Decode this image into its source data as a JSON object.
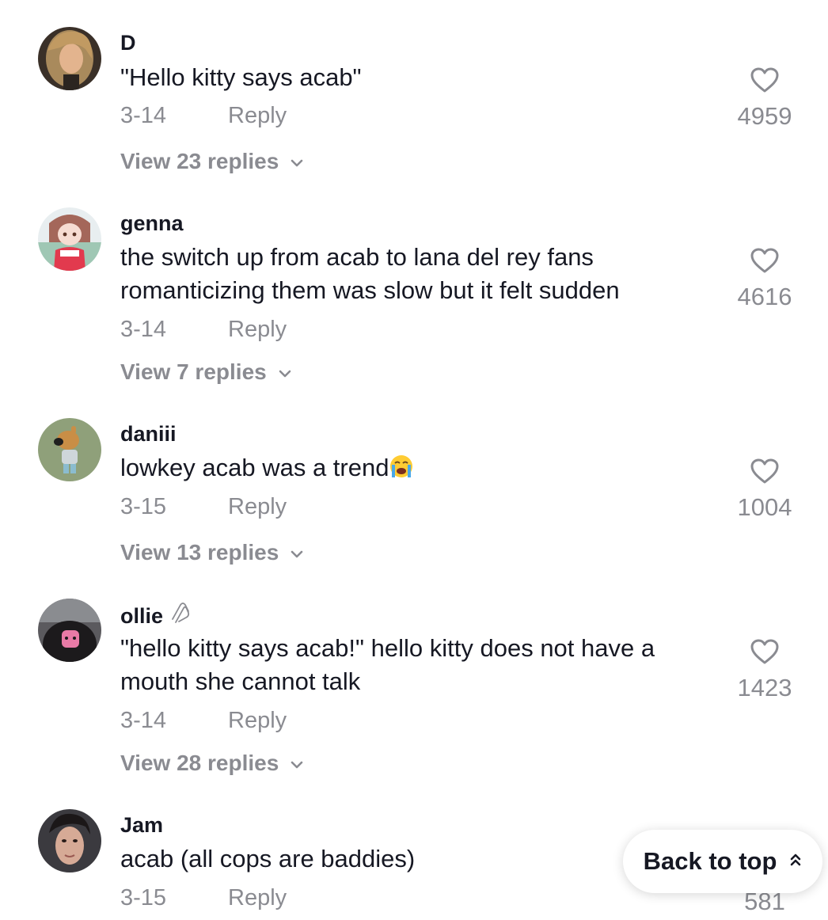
{
  "comments": [
    {
      "username": "D",
      "text": "\"Hello kitty says acab\"",
      "date": "3-14",
      "reply_label": "Reply",
      "likes": "4959",
      "view_replies": "View 23 replies"
    },
    {
      "username": "genna",
      "text": "the switch up from acab to lana del rey fans romanticizing them was slow but it felt sudden",
      "date": "3-14",
      "reply_label": "Reply",
      "likes": "4616",
      "view_replies": "View 7 replies"
    },
    {
      "username": "daniii",
      "text": "lowkey acab was a trend",
      "emoji": "loudly-crying-face-emoji",
      "date": "3-15",
      "reply_label": "Reply",
      "likes": "1004",
      "view_replies": "View 13 replies"
    },
    {
      "username": "ollie",
      "badge_icon": "paperclip-icon",
      "text": "\"hello kitty says acab!\" hello kitty does not have a mouth she cannot talk",
      "date": "3-14",
      "reply_label": "Reply",
      "likes": "1423",
      "view_replies": "View 28 replies"
    },
    {
      "username": "Jam",
      "text": "acab (all cops are baddies)",
      "date": "3-15",
      "reply_label": "Reply",
      "likes": "581"
    }
  ],
  "back_to_top": {
    "label": "Back to top",
    "icon": "double-chevron-up-icon"
  },
  "colors": {
    "primary_text": "#161823",
    "secondary_text": "#8a8b91",
    "background": "#ffffff"
  }
}
